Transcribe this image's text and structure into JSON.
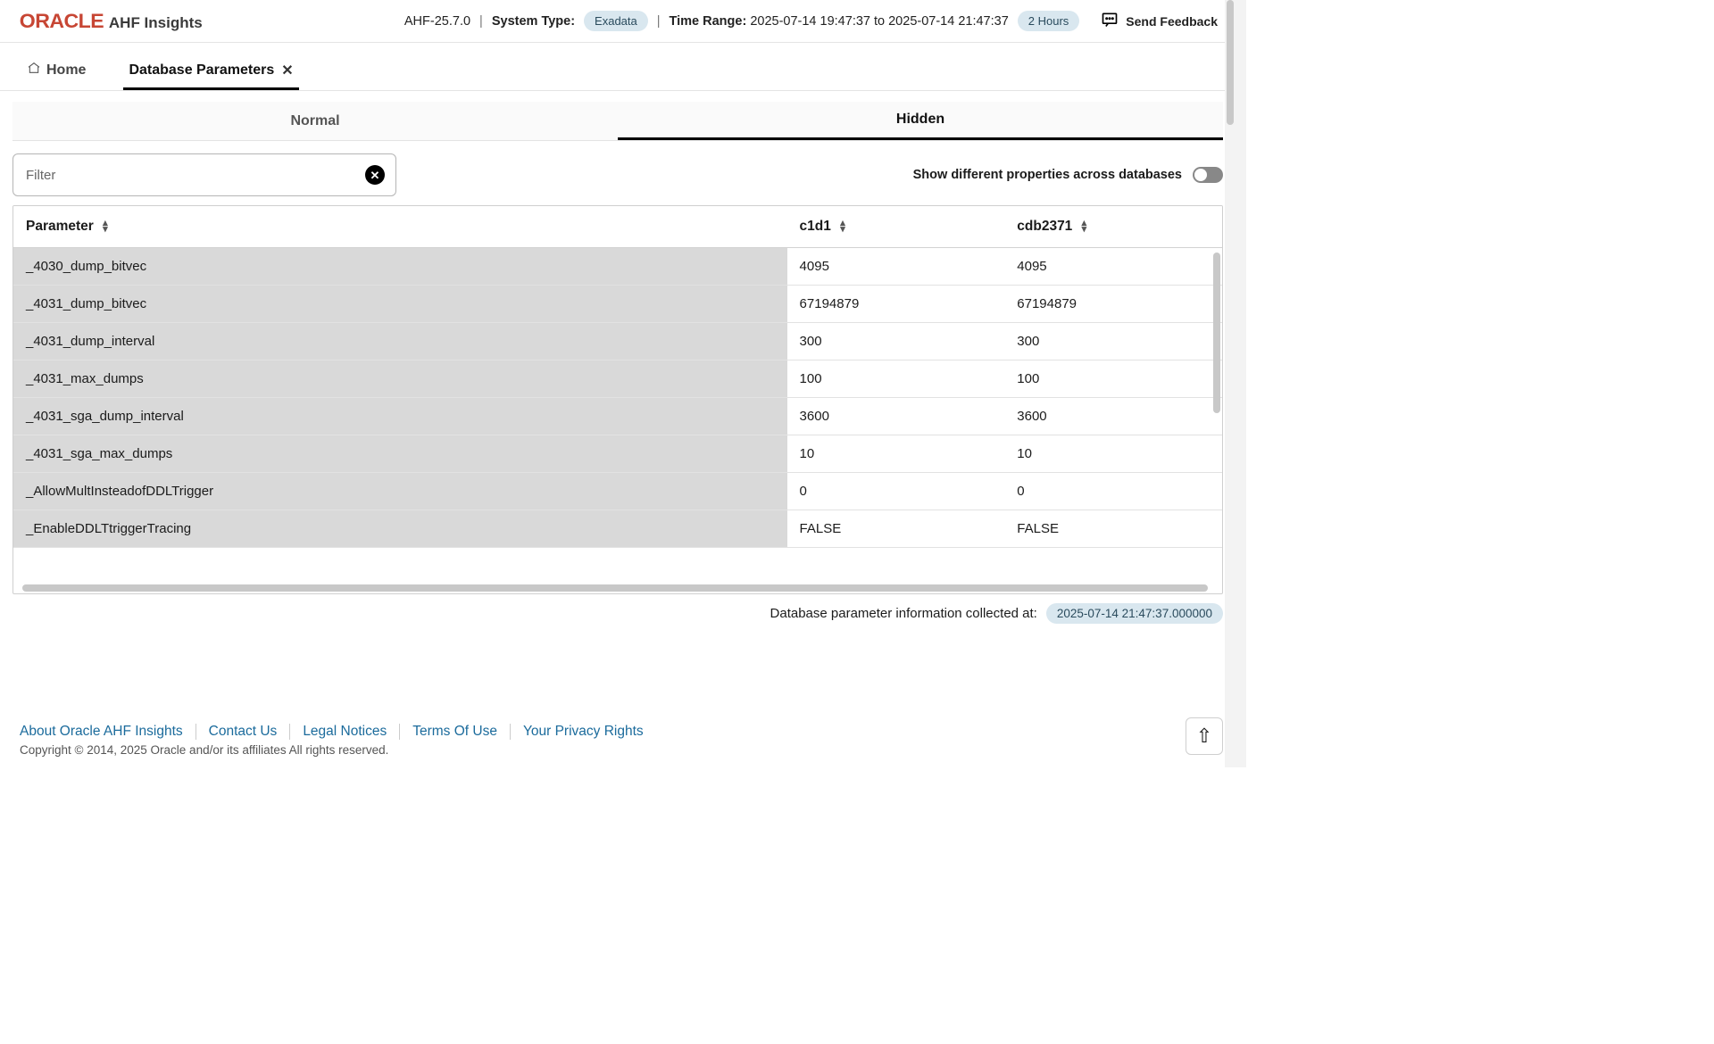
{
  "header": {
    "brand_logo": "ORACLE",
    "brand_sub": "AHF Insights",
    "version": "AHF-25.7.0",
    "system_type_label": "System Type:",
    "system_type_value": "Exadata",
    "time_range_label": "Time Range:",
    "time_range_value": "2025-07-14 19:47:37 to 2025-07-14 21:47:37",
    "duration_badge": "2 Hours",
    "feedback_label": "Send Feedback"
  },
  "nav_tabs": {
    "home": "Home",
    "db_params": "Database Parameters"
  },
  "subtabs": {
    "normal": "Normal",
    "hidden": "Hidden"
  },
  "filter": {
    "placeholder": "Filter",
    "value": "",
    "diff_toggle_label": "Show different properties across databases"
  },
  "table": {
    "columns": {
      "param": "Parameter",
      "c1": "c1d1",
      "c2": "cdb2371"
    },
    "rows": [
      {
        "param": "_4030_dump_bitvec",
        "c1": "4095",
        "c2": "4095"
      },
      {
        "param": "_4031_dump_bitvec",
        "c1": "67194879",
        "c2": "67194879"
      },
      {
        "param": "_4031_dump_interval",
        "c1": "300",
        "c2": "300"
      },
      {
        "param": "_4031_max_dumps",
        "c1": "100",
        "c2": "100"
      },
      {
        "param": "_4031_sga_dump_interval",
        "c1": "3600",
        "c2": "3600"
      },
      {
        "param": "_4031_sga_max_dumps",
        "c1": "10",
        "c2": "10"
      },
      {
        "param": "_AllowMultInsteadofDDLTrigger",
        "c1": "0",
        "c2": "0"
      },
      {
        "param": "_EnableDDLTtriggerTracing",
        "c1": "FALSE",
        "c2": "FALSE"
      }
    ]
  },
  "collected": {
    "label": "Database parameter information collected at:",
    "timestamp": "2025-07-14 21:47:37.000000"
  },
  "footer": {
    "links": [
      "About Oracle AHF Insights",
      "Contact Us",
      "Legal Notices",
      "Terms Of Use",
      "Your Privacy Rights"
    ],
    "copyright": "Copyright © 2014, 2025 Oracle and/or its affiliates All rights reserved."
  }
}
